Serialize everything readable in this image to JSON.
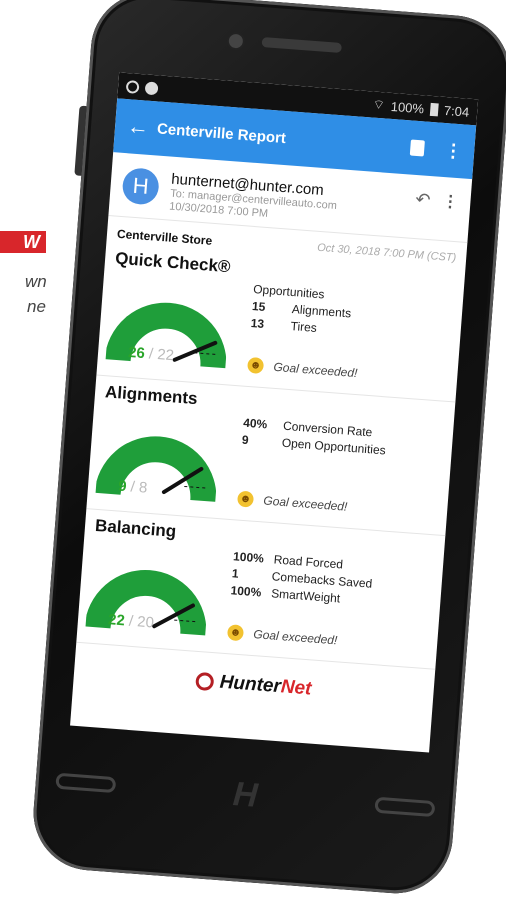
{
  "side_badge": "W",
  "side_lines": [
    "wn",
    "ne"
  ],
  "status_bar": {
    "signal": "100%",
    "time": "7:04"
  },
  "app_bar": {
    "back_glyph": "←",
    "title": "Centerville Report"
  },
  "email": {
    "avatar_letter": "H",
    "from": "hunternet@hunter.com",
    "to": "To: manager@centervilleauto.com",
    "sent": "10/30/2018  7:00 PM"
  },
  "report": {
    "store": "Centerville Store",
    "date": "Oct 30, 2018  7:00 PM (CST)"
  },
  "sections": [
    {
      "title": "Quick Check®",
      "actual": "26",
      "goal": "/ 22",
      "gauge_fraction": 0.85,
      "heading": "Opportunities",
      "stats": [
        {
          "value": "15",
          "label": "Alignments"
        },
        {
          "value": "13",
          "label": "Tires"
        }
      ],
      "goal_text": "Goal exceeded!"
    },
    {
      "title": "Alignments",
      "actual": "9",
      "goal": "/ 8",
      "gauge_fraction": 0.8,
      "heading": "",
      "stats": [
        {
          "value": "40%",
          "label": "Conversion Rate"
        },
        {
          "value": "9",
          "label": "Open Opportunities"
        }
      ],
      "goal_text": "Goal exceeded!"
    },
    {
      "title": "Balancing",
      "actual": "22",
      "goal": "/ 20",
      "gauge_fraction": 0.82,
      "heading": "",
      "stats": [
        {
          "value": "100%",
          "label": "Road Forced"
        },
        {
          "value": "1",
          "label": "Comebacks Saved"
        },
        {
          "value": "100%",
          "label": "SmartWeight"
        }
      ],
      "goal_text": "Goal exceeded!"
    }
  ],
  "footer": {
    "brand_a": "Hunter",
    "brand_b": "Net"
  },
  "colors": {
    "app_bar": "#2f8ee6",
    "gauge": "#1f9e3a",
    "badge": "#d8262b",
    "brand_red": "#d8262b"
  }
}
